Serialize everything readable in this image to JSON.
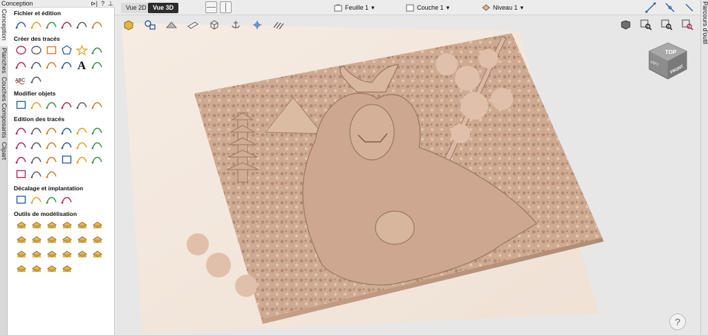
{
  "panel": {
    "title": "Conception",
    "sections": [
      {
        "title": "Fichier et édition",
        "tools": [
          "new-file-icon",
          "open-folder-icon",
          "import-icon",
          "export-icon",
          "settings-gear-icon",
          "component-icon"
        ]
      },
      {
        "title": "Créer des tracés",
        "tools": [
          "circle-icon",
          "ellipse-icon",
          "rectangle-icon",
          "polygon-icon",
          "star-icon",
          "line-icon",
          "arc-icon",
          "spiral-icon",
          "wave-icon",
          "dimension-icon",
          "text-icon",
          "text-on-curve-icon",
          "spell-text-icon",
          "bitmap-trace-icon"
        ]
      },
      {
        "title": "Modifier objets",
        "tools": [
          "move-icon",
          "scale-icon",
          "rotate-icon",
          "mirror-icon",
          "distort-icon",
          "align-icon"
        ]
      },
      {
        "title": "Edition des tracés",
        "tools": [
          "select-icon",
          "node-edit-icon",
          "add-node-icon",
          "transform-icon",
          "weld-icon",
          "measure-icon",
          "trim-icon",
          "extend-icon",
          "split-icon",
          "join-icon",
          "close-vectors-icon",
          "fillet-icon",
          "corner-icon",
          "curve-fit-icon",
          "smooth-icon",
          "offset-curve-icon",
          "convert-icon",
          "check-icon",
          "rounded-rect-icon",
          "soft-corner-icon",
          "chevron-icon"
        ]
      },
      {
        "title": "Décalage et implantation",
        "tools": [
          "offset-icon",
          "nest-icon",
          "array-copy-icon",
          "grid-array-icon"
        ]
      },
      {
        "title": "Outils de modélisation",
        "tools": [
          "model-sculpt-icon",
          "dome-icon",
          "extrude-icon",
          "sweep-icon",
          "rotate-shape-icon",
          "model-blend-icon",
          "texture-icon",
          "fade-icon",
          "merge-icon",
          "slice-icon",
          "bake-icon",
          "layer-icon",
          "box-icon",
          "smooth-model-icon",
          "flatten-icon",
          "move-model-icon",
          "tilt-icon",
          "mirror-model-icon",
          "component-import-icon",
          "clipart-icon",
          "distort-model-icon",
          "bake-flat-icon"
        ]
      }
    ]
  },
  "vtabs": [
    "Conception",
    "Planches",
    "Couches",
    "Composants",
    "Clipart"
  ],
  "rtab": "Parcours d'outil",
  "viewbar": {
    "view2d": "Vue 2D",
    "view3d": "Vue 3D",
    "sheet": "Feuille 1",
    "layer": "Couche 1",
    "level": "Niveau 1"
  },
  "help": "?",
  "viewcube": {
    "top": "TOP",
    "front": "FRONT",
    "left": "LEFT"
  },
  "colors": {
    "relief": "#c9a58c",
    "base": "#dfc3b0",
    "plate": "#f1e4d8",
    "panel": "#ffffff",
    "accent": "#2d2d2d"
  }
}
